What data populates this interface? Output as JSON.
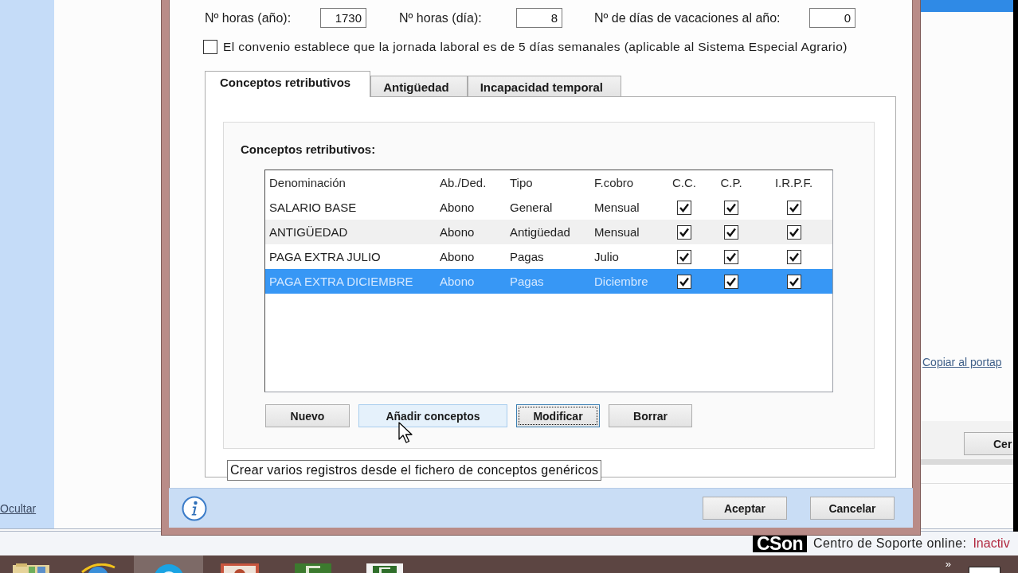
{
  "background_app": {
    "sidebar": {
      "hide_link": "Ocultar"
    },
    "copy_link": "Copiar al portap",
    "button": "Cer"
  },
  "dialog": {
    "fields": [
      {
        "label": "Nº horas (año):",
        "value": "1730"
      },
      {
        "label": "Nº horas (día):",
        "value": "8"
      },
      {
        "label": "Nº de días de vacaciones al año:",
        "value": "0"
      }
    ],
    "five_day_week": {
      "label": "El convenio establece que la jornada laboral es de 5 días semanales (aplicable al Sistema Especial Agrario)",
      "checked": false
    },
    "tabs": [
      {
        "label": "Conceptos retributivos",
        "selected": true
      },
      {
        "label": "Antigüedad",
        "selected": false
      },
      {
        "label": "Incapacidad temporal",
        "selected": false
      }
    ],
    "concepts": {
      "title": "Conceptos retributivos:",
      "columns": [
        "Denominación",
        "Ab./Ded.",
        "Tipo",
        "F.cobro",
        "C.C.",
        "C.P.",
        "I.R.P.F."
      ],
      "rows": [
        {
          "cells": [
            "SALARIO BASE",
            "Abono",
            "General",
            "Mensual"
          ],
          "checks": [
            true,
            true,
            true
          ],
          "selected": false
        },
        {
          "cells": [
            "ANTIGÜEDAD",
            "Abono",
            "Antigüedad",
            "Mensual"
          ],
          "checks": [
            true,
            true,
            true
          ],
          "selected": false
        },
        {
          "cells": [
            "PAGA EXTRA JULIO",
            "Abono",
            "Pagas",
            "Julio"
          ],
          "checks": [
            true,
            true,
            true
          ],
          "selected": false
        },
        {
          "cells": [
            "PAGA EXTRA DICIEMBRE",
            "Abono",
            "Pagas",
            "Diciembre"
          ],
          "checks": [
            true,
            true,
            true
          ],
          "selected": true
        }
      ],
      "buttons": [
        {
          "label": "Nuevo",
          "hovered": false,
          "focused": false
        },
        {
          "label": "Añadir conceptos",
          "hovered": true,
          "focused": false
        },
        {
          "label": "Modificar",
          "hovered": false,
          "focused": true
        },
        {
          "label": "Borrar",
          "hovered": false,
          "focused": false
        }
      ]
    },
    "tooltip": "Crear varios registros desde el fichero de conceptos genéricos",
    "footer_buttons": [
      "Aceptar",
      "Cancelar"
    ]
  },
  "status_bar": {
    "logo": "CSon",
    "label": "Centro de Soporte online:",
    "status": "Inactiv"
  },
  "taskbar": {
    "items": [
      {
        "kind": "folder",
        "selected": false
      },
      {
        "kind": "browser",
        "selected": false
      },
      {
        "kind": "chat",
        "selected": true
      },
      {
        "kind": "presentation",
        "selected": false
      },
      {
        "kind": "app",
        "selected": false
      },
      {
        "kind": "app_light",
        "selected": false
      }
    ],
    "overflow": "»"
  }
}
